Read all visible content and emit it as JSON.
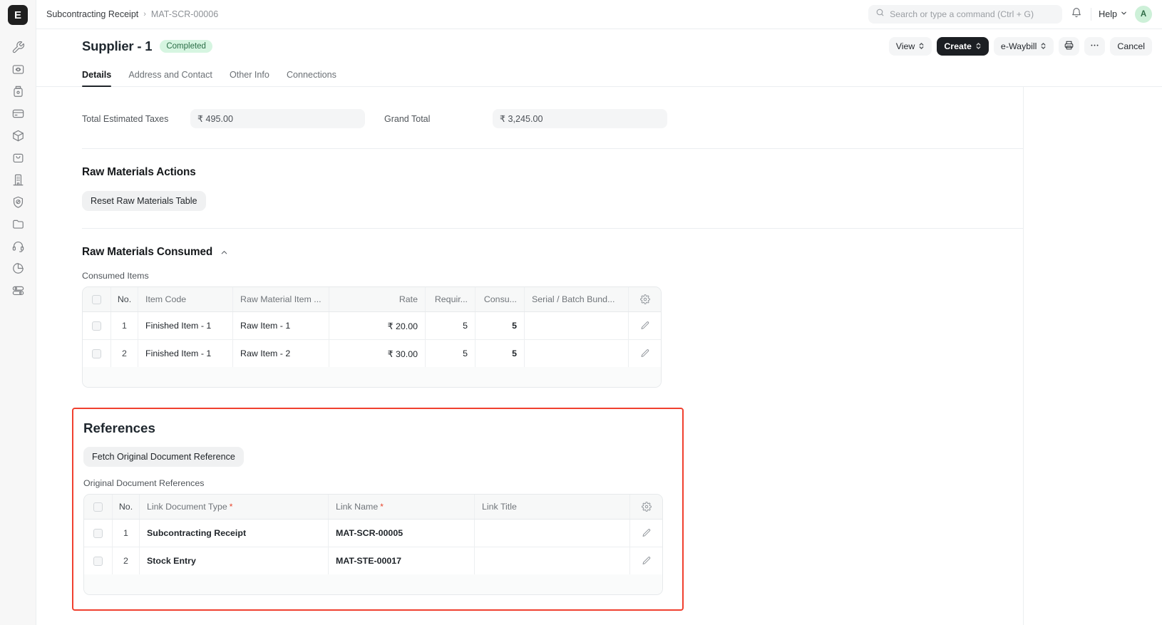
{
  "sidebar": {
    "logo_letter": "E",
    "items": [
      {
        "name": "tools-icon"
      },
      {
        "name": "monitor-eye-icon"
      },
      {
        "name": "jar-icon"
      },
      {
        "name": "card-icon"
      },
      {
        "name": "box-icon"
      },
      {
        "name": "shopping-bag-icon"
      },
      {
        "name": "building-icon"
      },
      {
        "name": "shield-check-icon"
      },
      {
        "name": "folder-icon"
      },
      {
        "name": "headset-icon"
      },
      {
        "name": "pie-chart-icon"
      },
      {
        "name": "toggle-icon"
      }
    ]
  },
  "navbar": {
    "breadcrumb_parent": "Subcontracting Receipt",
    "breadcrumb_separator": "›",
    "breadcrumb_current": "MAT-SCR-00006",
    "search_placeholder": "Search or type a command (Ctrl + G)",
    "search_value": "",
    "help_label": "Help",
    "avatar_initial": "A"
  },
  "page": {
    "title": "Supplier - 1",
    "status_badge": "Completed",
    "actions": {
      "view": "View",
      "create": "Create",
      "ewaybill": "e-Waybill",
      "cancel": "Cancel",
      "print_icon": "printer-icon",
      "more_icon": "ellipsis-icon"
    },
    "tabs": [
      {
        "label": "Details",
        "active": true
      },
      {
        "label": "Address and Contact",
        "active": false
      },
      {
        "label": "Other Info",
        "active": false
      },
      {
        "label": "Connections",
        "active": false
      }
    ]
  },
  "totals": {
    "total_estimated_taxes_label": "Total Estimated Taxes",
    "total_estimated_taxes_value": "₹ 495.00",
    "grand_total_label": "Grand Total",
    "grand_total_value": "₹ 3,245.00"
  },
  "raw_materials_actions": {
    "heading": "Raw Materials Actions",
    "reset_button": "Reset Raw Materials Table"
  },
  "raw_materials_consumed": {
    "heading": "Raw Materials Consumed",
    "collapse_icon": "chevron-up-icon",
    "grid_label": "Consumed Items",
    "columns": [
      "No.",
      "Item Code",
      "Raw Material Item ...",
      "Rate",
      "Requir...",
      "Consu...",
      "Serial / Batch Bund..."
    ],
    "settings_icon": "gear-icon",
    "rows": [
      {
        "no": "1",
        "item_code": "Finished Item - 1",
        "raw_material_item": "Raw Item - 1",
        "rate": "₹ 20.00",
        "required": "5",
        "consumed": "5",
        "serial_batch": "",
        "edit_icon": "pencil-icon"
      },
      {
        "no": "2",
        "item_code": "Finished Item - 1",
        "raw_material_item": "Raw Item - 2",
        "rate": "₹ 30.00",
        "required": "5",
        "consumed": "5",
        "serial_batch": "",
        "edit_icon": "pencil-icon"
      }
    ]
  },
  "references": {
    "heading": "References",
    "fetch_button": "Fetch Original Document Reference",
    "grid_label": "Original Document References",
    "columns": [
      {
        "label": "No.",
        "required": false
      },
      {
        "label": "Link Document Type",
        "required": true
      },
      {
        "label": "Link Name",
        "required": true
      },
      {
        "label": "Link Title",
        "required": false
      }
    ],
    "required_marker": "*",
    "settings_icon": "gear-icon",
    "rows": [
      {
        "no": "1",
        "link_document_type": "Subcontracting Receipt",
        "link_name": "MAT-SCR-00005",
        "link_title": "",
        "edit_icon": "pencil-icon"
      },
      {
        "no": "2",
        "link_document_type": "Stock Entry",
        "link_name": "MAT-STE-00017",
        "link_title": "",
        "edit_icon": "pencil-icon"
      }
    ],
    "highlight_color": "#f0402f"
  },
  "colors": {
    "badge_bg": "#d6f5e1",
    "badge_text": "#2b6e47",
    "primary_button_bg": "#1c1f23",
    "sidebar_bg": "#f7f7f7",
    "border": "#ebeef0"
  }
}
